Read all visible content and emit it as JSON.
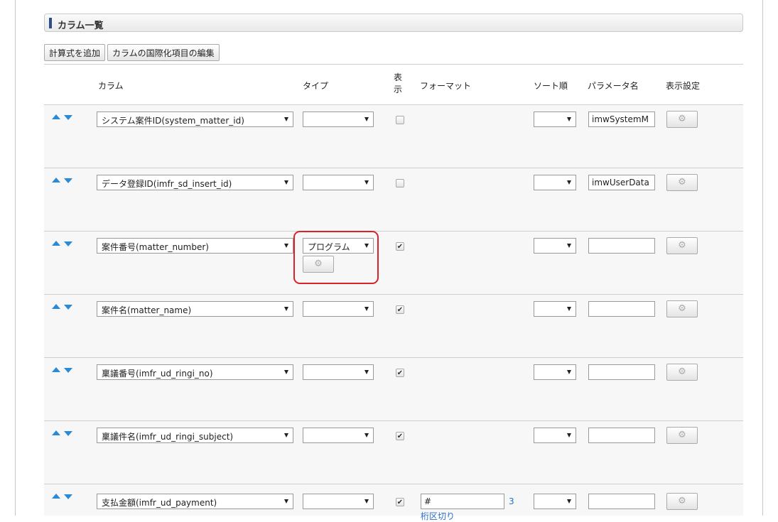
{
  "section": {
    "title": "カラム一覧"
  },
  "toolbar": {
    "add_formula_label": "計算式を追加",
    "edit_i18n_label": "カラムの国際化項目の編集"
  },
  "table": {
    "headers": {
      "column": "カラム",
      "type": "タイプ",
      "display": "表示",
      "format": "フォーマット",
      "sort_order": "ソート順",
      "param_name": "パラメータ名",
      "display_settings": "表示設定"
    },
    "rows": [
      {
        "column": "システム案件ID(system_matter_id)",
        "type": "",
        "display_checked": false,
        "format": "",
        "sort": "",
        "param": "imwSystemM"
      },
      {
        "column": "データ登録ID(imfr_sd_insert_id)",
        "type": "",
        "display_checked": false,
        "format": "",
        "sort": "",
        "param": "imwUserData"
      },
      {
        "column": "案件番号(matter_number)",
        "type": "プログラム",
        "display_checked": true,
        "format": "",
        "sort": "",
        "param": ""
      },
      {
        "column": "案件名(matter_name)",
        "type": "",
        "display_checked": true,
        "format": "",
        "sort": "",
        "param": ""
      },
      {
        "column": "稟議番号(imfr_ud_ringi_no)",
        "type": "",
        "display_checked": true,
        "format": "",
        "sort": "",
        "param": ""
      },
      {
        "column": "稟議件名(imfr_ud_ringi_subject)",
        "type": "",
        "display_checked": true,
        "format": "",
        "sort": "",
        "param": ""
      },
      {
        "column": "支払金額(imfr_ud_payment)",
        "type": "",
        "display_checked": true,
        "format": "#",
        "format_digits": "3",
        "format_link": "桁区切り",
        "sort": "",
        "param": ""
      }
    ]
  },
  "icons": {
    "up": "arrow-up-icon",
    "down": "arrow-down-icon",
    "gear": "gear-icon",
    "check": "checkmark-icon"
  },
  "colors": {
    "accent_bar": "#2c4e8c",
    "arrow": "#2a8ad6",
    "highlight": "#d9232b",
    "link": "#2a6fc7"
  }
}
